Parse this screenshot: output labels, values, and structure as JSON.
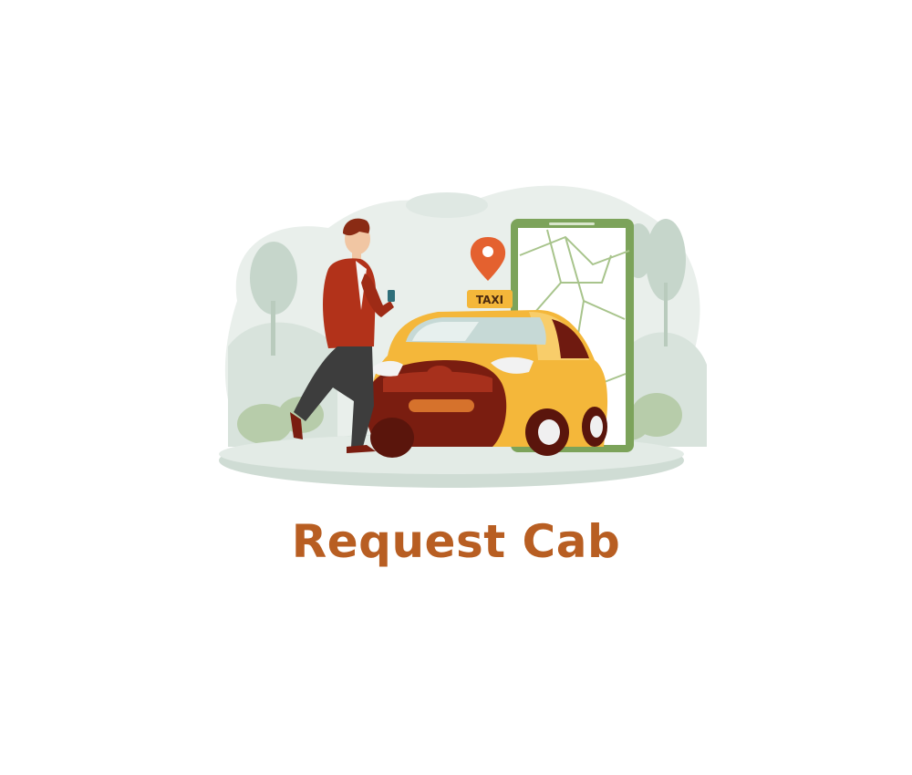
{
  "screen": {
    "title": "Request Cab",
    "illustration": {
      "taxi_sign": "TAXI",
      "icons": [
        "map-pin-icon",
        "phone-map-icon",
        "taxi-car-icon",
        "person-icon"
      ]
    }
  },
  "colors": {
    "title": "#b85e22",
    "taxi_yellow": "#f4b73a",
    "taxi_dark": "#7a1d10",
    "jacket": "#b2321a",
    "phone_green": "#7ca35a",
    "pin_orange": "#e4612f",
    "background_sage": "#dfe8e3"
  }
}
